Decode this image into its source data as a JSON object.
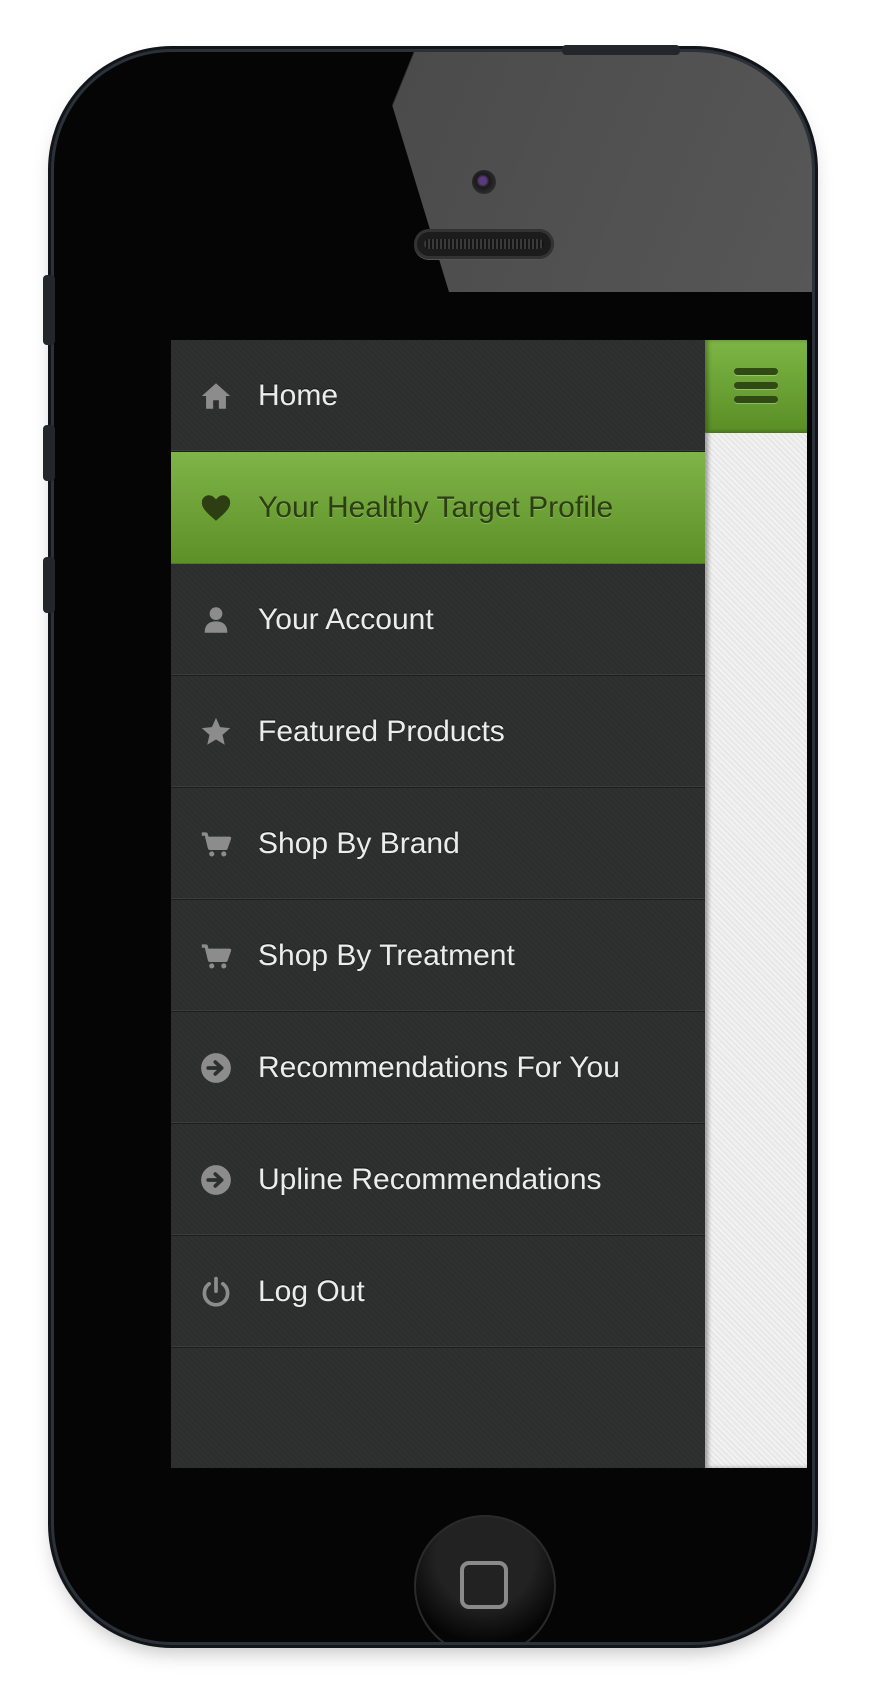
{
  "menu": {
    "items": [
      {
        "label": "Home",
        "icon": "home-icon",
        "active": false
      },
      {
        "label": "Your Healthy Target Profile",
        "icon": "heart-icon",
        "active": true
      },
      {
        "label": "Your Account",
        "icon": "user-icon",
        "active": false
      },
      {
        "label": "Featured Products",
        "icon": "star-icon",
        "active": false
      },
      {
        "label": "Shop By Brand",
        "icon": "cart-icon",
        "active": false
      },
      {
        "label": "Shop By Treatment",
        "icon": "cart-icon",
        "active": false
      },
      {
        "label": "Recommendations For You",
        "icon": "arrow-circle-icon",
        "active": false
      },
      {
        "label": "Upline Recommendations",
        "icon": "arrow-circle-icon",
        "active": false
      },
      {
        "label": "Log Out",
        "icon": "power-icon",
        "active": false
      }
    ]
  },
  "topbar": {
    "menu_button_icon": "hamburger-icon"
  },
  "colors": {
    "accent_green": "#6ea637",
    "menu_background": "#2d2e2e",
    "menu_text": "#ececec",
    "content_background": "#ececec"
  }
}
